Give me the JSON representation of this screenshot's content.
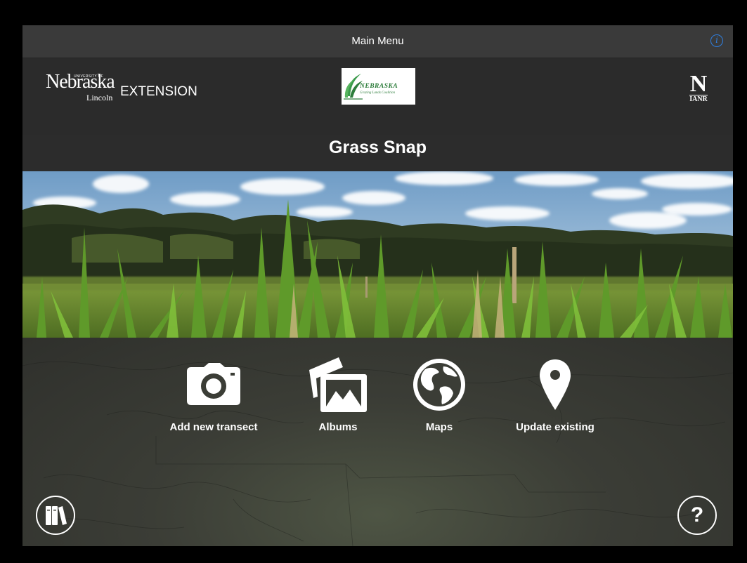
{
  "navbar": {
    "title": "Main Menu",
    "info_icon": "info-icon",
    "info_color": "#2f7fe0"
  },
  "logos": {
    "unl": {
      "university_of": "UNIVERSITY OF",
      "nebraska": "Nebraska",
      "lincoln": "Lincoln",
      "extension": "EXTENSION"
    },
    "grazing": {
      "name": "NEBRASKA",
      "tagline": "Grazing Lands Coalition"
    },
    "ianr": {
      "letter": "N",
      "sub": "IANR"
    }
  },
  "app": {
    "title": "Grass Snap"
  },
  "menu": [
    {
      "label": "Add new transect",
      "icon": "camera-icon"
    },
    {
      "label": "Albums",
      "icon": "photo-albums-icon"
    },
    {
      "label": "Maps",
      "icon": "globe-icon"
    },
    {
      "label": "Update existing",
      "icon": "map-pin-icon"
    }
  ],
  "bottom": {
    "library_icon": "library-books-icon",
    "help_label": "?",
    "help_icon": "help-icon"
  }
}
